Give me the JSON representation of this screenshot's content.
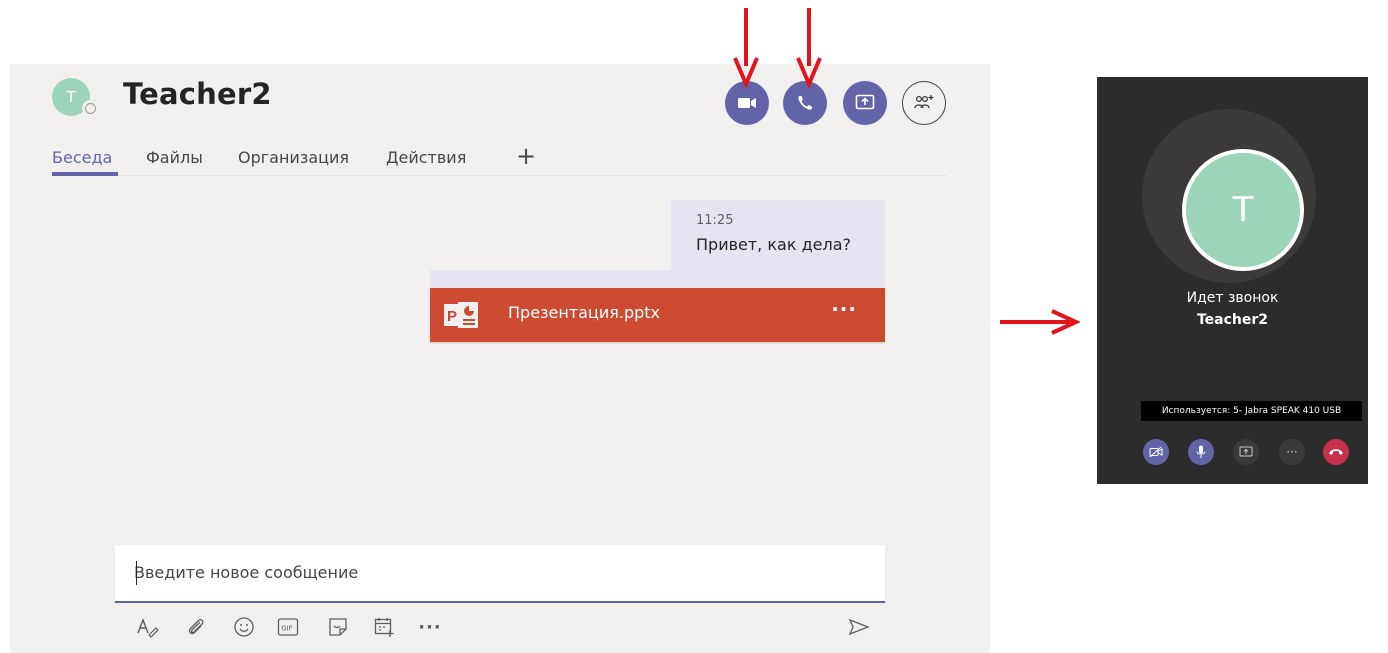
{
  "chat": {
    "avatar_initial": "T",
    "title": "Teacher2",
    "tabs": [
      {
        "label": "Беседа"
      },
      {
        "label": "Файлы"
      },
      {
        "label": "Организация"
      },
      {
        "label": "Действия"
      }
    ],
    "message": {
      "time": "11:25",
      "text": "Привет, как дела?"
    },
    "attachment": {
      "file_name": "Презентация.pptx",
      "more": "···"
    },
    "compose": {
      "placeholder": "Введите новое сообщение"
    },
    "toolbar": {
      "more": "···"
    }
  },
  "call": {
    "avatar_initial": "T",
    "status": "Идет звонок",
    "name": "Teacher2",
    "device_tooltip": "Используется: 5- Jabra SPEAK 410 USB",
    "more": "···"
  },
  "colors": {
    "accent": "#6264a7",
    "powerpoint": "#cc4a31",
    "annotation": "#e3131b",
    "hangup": "#c4314b",
    "avatar": "#9bd4b8"
  }
}
